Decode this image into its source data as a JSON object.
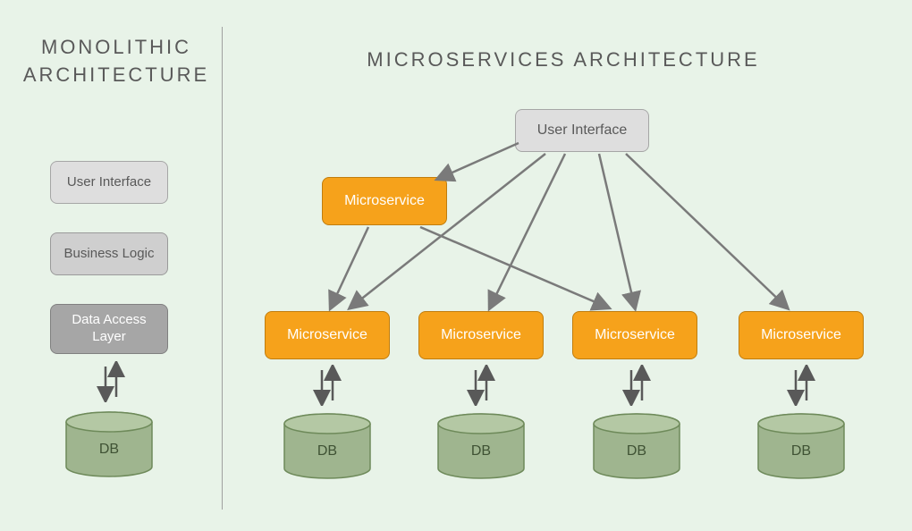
{
  "monolithic": {
    "title": "MONOLITHIC ARCHITECTURE",
    "ui": "User Interface",
    "logic": "Business Logic",
    "dal": "Data Access Layer",
    "db": "DB"
  },
  "microservices": {
    "title": "MICROSERVICES ARCHITECTURE",
    "ui": "User Interface",
    "ms_top": "Microservice",
    "ms1": "Microservice",
    "ms2": "Microservice",
    "ms3": "Microservice",
    "ms4": "Microservice",
    "db1": "DB",
    "db2": "DB",
    "db3": "DB",
    "db4": "DB"
  }
}
